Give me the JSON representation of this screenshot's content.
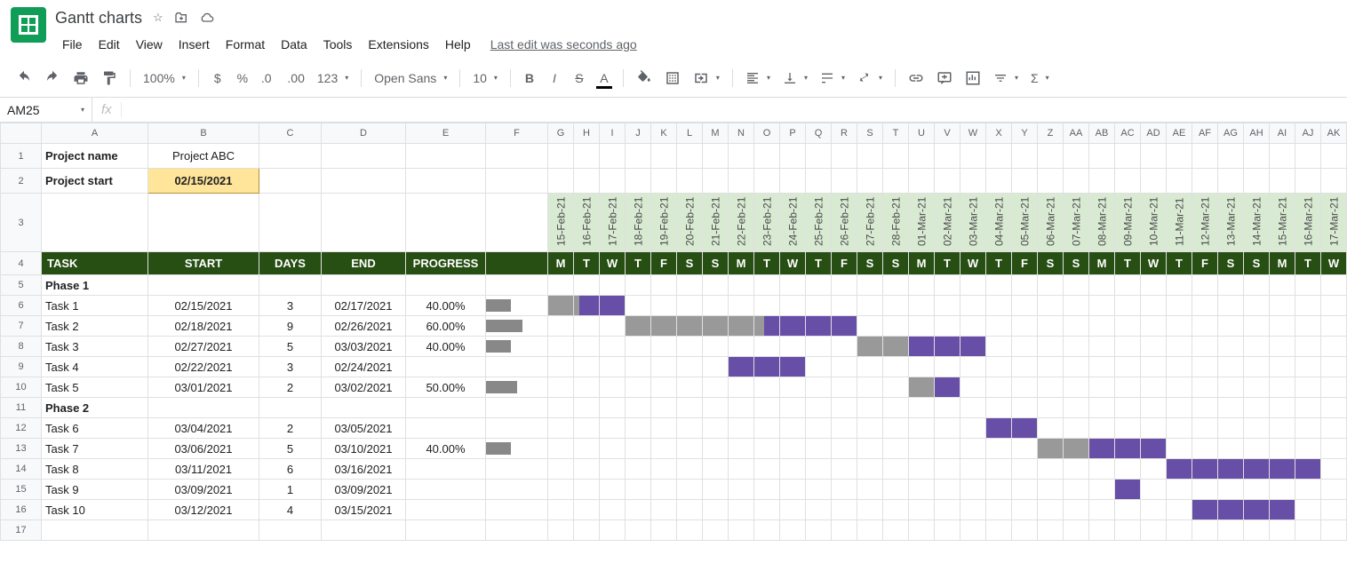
{
  "doc": {
    "title": "Gantt charts",
    "lastEdit": "Last edit was seconds ago"
  },
  "menu": [
    "File",
    "Edit",
    "View",
    "Insert",
    "Format",
    "Data",
    "Tools",
    "Extensions",
    "Help"
  ],
  "toolbar": {
    "zoom": "100%",
    "font": "Open Sans",
    "fontSize": "10",
    "moreFormats": "123"
  },
  "cellRef": "AM25",
  "formula": "",
  "colsMain": [
    "A",
    "B",
    "C",
    "D",
    "E",
    "F"
  ],
  "colsDays": [
    "G",
    "H",
    "I",
    "J",
    "K",
    "L",
    "M",
    "N",
    "O",
    "P",
    "Q",
    "R",
    "S",
    "T",
    "U",
    "V",
    "W",
    "X",
    "Y",
    "Z",
    "AA",
    "AB",
    "AC",
    "AD",
    "AE",
    "AF",
    "AG",
    "AH",
    "AI",
    "AJ",
    "AK"
  ],
  "meta": {
    "projectNameLabel": "Project name",
    "projectName": "Project ABC",
    "projectStartLabel": "Project start",
    "projectStart": "02/15/2021"
  },
  "dates": [
    "15-Feb-21",
    "16-Feb-21",
    "17-Feb-21",
    "18-Feb-21",
    "19-Feb-21",
    "20-Feb-21",
    "21-Feb-21",
    "22-Feb-21",
    "23-Feb-21",
    "24-Feb-21",
    "25-Feb-21",
    "26-Feb-21",
    "27-Feb-21",
    "28-Feb-21",
    "01-Mar-21",
    "02-Mar-21",
    "03-Mar-21",
    "04-Mar-21",
    "05-Mar-21",
    "06-Mar-21",
    "07-Mar-21",
    "08-Mar-21",
    "09-Mar-21",
    "10-Mar-21",
    "11-Mar-21",
    "12-Mar-21",
    "13-Mar-21",
    "14-Mar-21",
    "15-Mar-21",
    "16-Mar-21",
    "17-Mar-21"
  ],
  "dow": [
    "M",
    "T",
    "W",
    "T",
    "F",
    "S",
    "S",
    "M",
    "T",
    "W",
    "T",
    "F",
    "S",
    "S",
    "M",
    "T",
    "W",
    "T",
    "F",
    "S",
    "S",
    "M",
    "T",
    "W",
    "T",
    "F",
    "S",
    "S",
    "M",
    "T",
    "W"
  ],
  "headers": {
    "task": "TASK",
    "start": "START",
    "days": "DAYS",
    "end": "END",
    "progress": "PROGRESS"
  },
  "phases": {
    "phase1": "Phase 1",
    "phase2": "Phase 2"
  },
  "tasks": [
    {
      "row": 5,
      "type": "phase",
      "label": "Phase 1"
    },
    {
      "row": 6,
      "type": "task",
      "name": "Task 1",
      "start": "02/15/2021",
      "days": "3",
      "end": "02/17/2021",
      "progress": "40.00%",
      "pbar": 40,
      "gantt": {
        "s": 0,
        "len": 3,
        "done": 40
      }
    },
    {
      "row": 7,
      "type": "task",
      "name": "Task 2",
      "start": "02/18/2021",
      "days": "9",
      "end": "02/26/2021",
      "progress": "60.00%",
      "pbar": 60,
      "gantt": {
        "s": 3,
        "len": 9,
        "done": 60
      }
    },
    {
      "row": 8,
      "type": "task",
      "name": "Task 3",
      "start": "02/27/2021",
      "days": "5",
      "end": "03/03/2021",
      "progress": "40.00%",
      "pbar": 40,
      "gantt": {
        "s": 12,
        "len": 5,
        "done": 40
      }
    },
    {
      "row": 9,
      "type": "task",
      "name": "Task 4",
      "start": "02/22/2021",
      "days": "3",
      "end": "02/24/2021",
      "progress": "",
      "pbar": null,
      "gantt": {
        "s": 7,
        "len": 3,
        "done": 0
      }
    },
    {
      "row": 10,
      "type": "task",
      "name": "Task 5",
      "start": "03/01/2021",
      "days": "2",
      "end": "03/02/2021",
      "progress": "50.00%",
      "pbar": 50,
      "gantt": {
        "s": 14,
        "len": 2,
        "done": 50
      }
    },
    {
      "row": 11,
      "type": "phase",
      "label": "Phase 2"
    },
    {
      "row": 12,
      "type": "task",
      "name": "Task 6",
      "start": "03/04/2021",
      "days": "2",
      "end": "03/05/2021",
      "progress": "",
      "pbar": null,
      "gantt": {
        "s": 17,
        "len": 2,
        "done": 0
      }
    },
    {
      "row": 13,
      "type": "task",
      "name": "Task 7",
      "start": "03/06/2021",
      "days": "5",
      "end": "03/10/2021",
      "progress": "40.00%",
      "pbar": 40,
      "gantt": {
        "s": 19,
        "len": 5,
        "done": 40
      }
    },
    {
      "row": 14,
      "type": "task",
      "name": "Task 8",
      "start": "03/11/2021",
      "days": "6",
      "end": "03/16/2021",
      "progress": "",
      "pbar": null,
      "gantt": {
        "s": 24,
        "len": 6,
        "done": 0
      }
    },
    {
      "row": 15,
      "type": "task",
      "name": "Task 9",
      "start": "03/09/2021",
      "days": "1",
      "end": "03/09/2021",
      "progress": "",
      "pbar": null,
      "gantt": {
        "s": 22,
        "len": 1,
        "done": 0
      }
    },
    {
      "row": 16,
      "type": "task",
      "name": "Task 10",
      "start": "03/12/2021",
      "days": "4",
      "end": "03/15/2021",
      "progress": "",
      "pbar": null,
      "gantt": {
        "s": 25,
        "len": 4,
        "done": 0
      }
    },
    {
      "row": 17,
      "type": "empty"
    }
  ]
}
